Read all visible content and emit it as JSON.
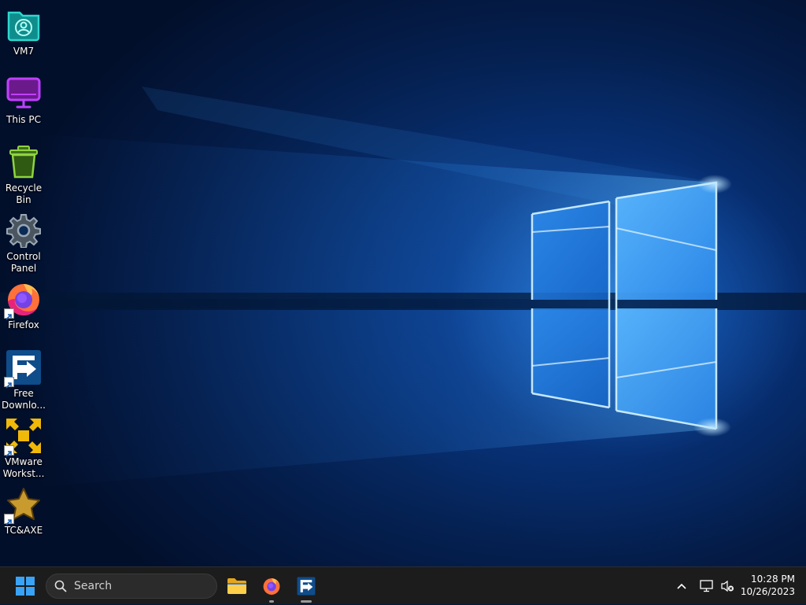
{
  "desktop": {
    "icons": [
      {
        "label": "VM7",
        "icon": "user-folder-icon",
        "shortcut": false
      },
      {
        "label": "This PC",
        "icon": "monitor-icon",
        "shortcut": false
      },
      {
        "label": "Recycle Bin",
        "icon": "recycle-bin-icon",
        "shortcut": false
      },
      {
        "label": "Control Panel",
        "icon": "gear-icon",
        "shortcut": false
      },
      {
        "label": "Firefox",
        "icon": "firefox-icon",
        "shortcut": true
      },
      {
        "label": "Free Downlo...",
        "icon": "free-download-manager-icon",
        "shortcut": true
      },
      {
        "label": "VMware Workst...",
        "icon": "vmware-icon",
        "shortcut": true
      },
      {
        "label": "TC&AXE",
        "icon": "star-icon",
        "shortcut": true
      }
    ]
  },
  "taskbar": {
    "start_icon": "windows-logo-icon",
    "search_placeholder": "Search",
    "pinned": [
      {
        "name": "File Explorer",
        "icon": "folder-icon",
        "running": false
      },
      {
        "name": "Firefox",
        "icon": "firefox-icon",
        "running": true
      },
      {
        "name": "Free Download Manager",
        "icon": "free-download-manager-icon",
        "running": true
      }
    ],
    "tray": {
      "overflow_icon": "chevron-up-icon",
      "network_icon": "network-icon",
      "volume_icon": "volume-muted-icon"
    },
    "clock": {
      "time": "10:28 PM",
      "date": "10/26/2023"
    }
  },
  "colors": {
    "taskbar_bg": "#1c1c1c",
    "wallpaper_light": "#7fd0ff",
    "windows_blue": "#3aa3f5"
  }
}
